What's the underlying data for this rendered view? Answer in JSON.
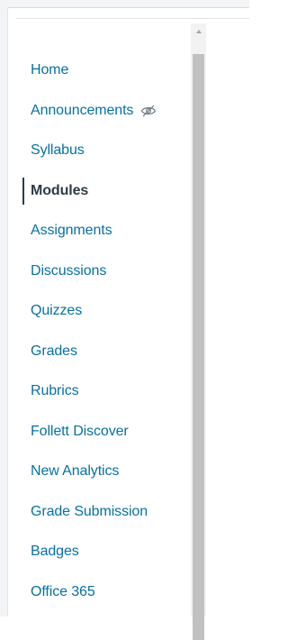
{
  "course_nav": {
    "items": [
      {
        "label": "Home",
        "active": false,
        "hidden": false
      },
      {
        "label": "Announcements",
        "active": false,
        "hidden": true,
        "icon": "eye-off-icon"
      },
      {
        "label": "Syllabus",
        "active": false,
        "hidden": false
      },
      {
        "label": "Modules",
        "active": true,
        "hidden": false
      },
      {
        "label": "Assignments",
        "active": false,
        "hidden": false
      },
      {
        "label": "Discussions",
        "active": false,
        "hidden": false
      },
      {
        "label": "Quizzes",
        "active": false,
        "hidden": false
      },
      {
        "label": "Grades",
        "active": false,
        "hidden": false
      },
      {
        "label": "Rubrics",
        "active": false,
        "hidden": false
      },
      {
        "label": "Follett Discover",
        "active": false,
        "hidden": false
      },
      {
        "label": "New Analytics",
        "active": false,
        "hidden": false
      },
      {
        "label": "Grade Submission",
        "active": false,
        "hidden": false
      },
      {
        "label": "Badges",
        "active": false,
        "hidden": false
      },
      {
        "label": "Office 365",
        "active": false,
        "hidden": false
      }
    ]
  },
  "colors": {
    "link": "#0770a3",
    "active_text": "#2d3b45",
    "scrollbar_track": "#f2f2f2",
    "scrollbar_thumb": "#c1c1c1"
  }
}
